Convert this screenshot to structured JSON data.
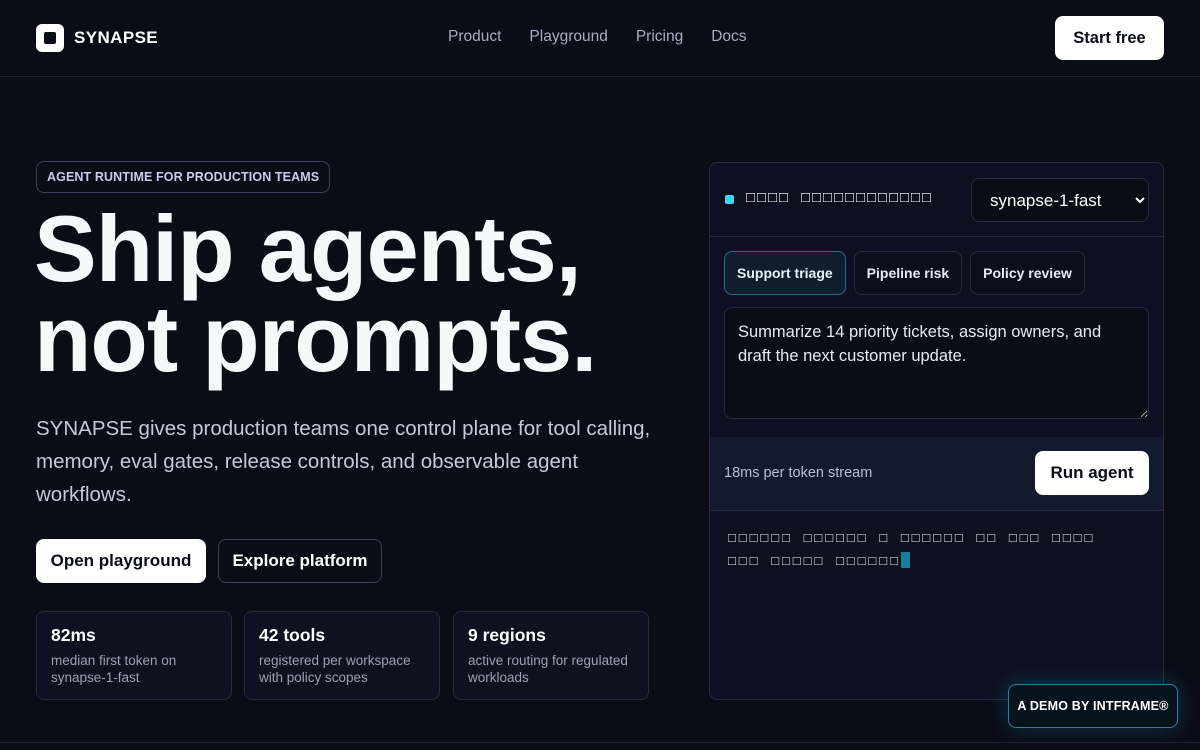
{
  "header": {
    "logo_text": "SYNAPSE",
    "nav": [
      "Product",
      "Playground",
      "Pricing",
      "Docs"
    ],
    "cta_label": "Start free"
  },
  "hero": {
    "badge": "AGENT RUNTIME FOR PRODUCTION TEAMS",
    "headline_line1": "Ship agents,",
    "headline_line2": "not prompts.",
    "subtext": "SYNAPSE gives production teams one control plane for tool calling, memory, eval gates, release controls, and observable agent workflows.",
    "primary_cta": "Open playground",
    "secondary_cta": "Explore platform",
    "stats": [
      {
        "value": "82ms",
        "desc": "median first token on synapse-1-fast"
      },
      {
        "value": "42 tools",
        "desc": "registered per workspace with policy scopes"
      },
      {
        "value": "9 regions",
        "desc": "active routing for regulated workloads"
      }
    ]
  },
  "demo": {
    "title_glyphs": "□□□□ □□□□□□□□□□□□",
    "model_selected": "synapse-1-fast",
    "tabs": [
      "Support triage",
      "Pipeline risk",
      "Policy review"
    ],
    "active_tab_index": 0,
    "prompt": "Summarize 14 priority tickets, assign owners, and draft the next customer update.",
    "latency": "18ms per token stream",
    "run_label": "Run agent",
    "output_line1": "□□□□□□ □□□□□□ □ □□□□□□ □□ □□□ □□□□",
    "output_line2": "□□□ □□□□□ □□□□□□",
    "accent_color": "#3dd6f5"
  },
  "demo_badge": "A DEMO BY INTFRAME®"
}
